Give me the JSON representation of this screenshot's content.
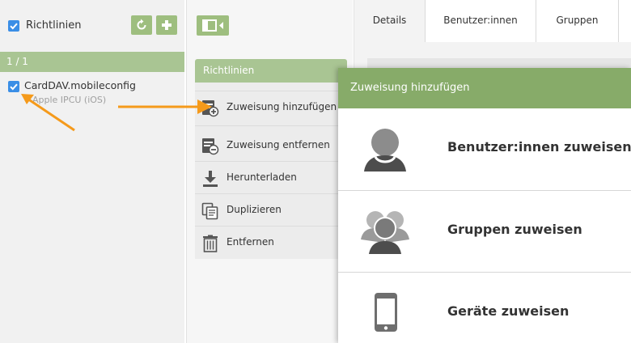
{
  "left": {
    "title": "Richtlinien",
    "count": "1 / 1",
    "item": {
      "name": "CardDAV.mobileconfig",
      "subtitle": "Apple IPCU (iOS)"
    }
  },
  "actions": {
    "title": "Richtlinien",
    "items": [
      {
        "label": "Zuweisung hinzufügen",
        "icon": "assign-add-icon"
      },
      {
        "label": "Zuweisung entfernen",
        "icon": "assign-remove-icon"
      },
      {
        "label": "Herunterladen",
        "icon": "download-icon"
      },
      {
        "label": "Duplizieren",
        "icon": "duplicate-icon"
      },
      {
        "label": "Entfernen",
        "icon": "trash-icon"
      }
    ]
  },
  "tabs": [
    "Details",
    "Benutzer:innen",
    "Gruppen"
  ],
  "overlay": {
    "title": "Zuweisung hinzufügen",
    "options": [
      {
        "label": "Benutzer:innen zuweisen",
        "icon": "user-icon"
      },
      {
        "label": "Gruppen zuweisen",
        "icon": "group-icon"
      },
      {
        "label": "Geräte zuweisen",
        "icon": "phone-icon"
      }
    ]
  },
  "colors": {
    "accent_green": "#9ebe7f",
    "header_green": "#87ab69",
    "checkbox_blue": "#3a8ee6",
    "arrow_orange": "#f59a1b"
  }
}
